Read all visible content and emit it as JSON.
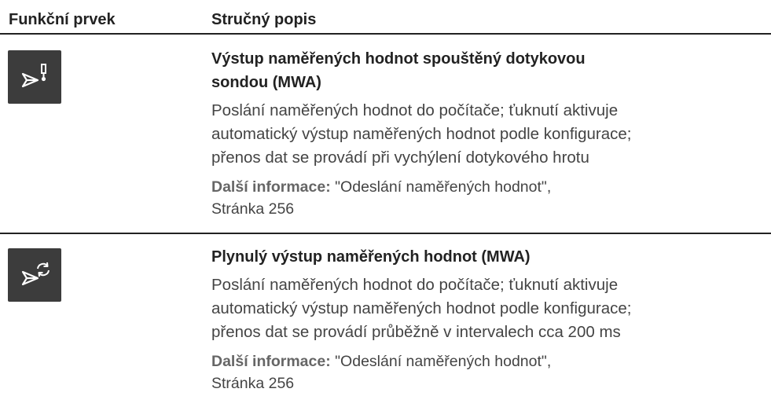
{
  "header": {
    "col1": "Funkční prvek",
    "col2": "Stručný popis"
  },
  "rows": [
    {
      "icon": "probe-triggered-output-icon",
      "title_line1": "Výstup naměřených hodnot spouštěný dotykovou",
      "title_line2": "sondou (MWA)",
      "body_line1": "Poslání naměřených hodnot do počítače; ťuknutí aktivuje",
      "body_line2": "automatický výstup naměřených hodnot podle konfigurace;",
      "body_line3": "přenos dat se provádí při vychýlení dotykového hrotu",
      "more_label": "Další informace:",
      "more_ref": " \"Odeslání naměřených hodnot\",",
      "more_page": "Stránka 256"
    },
    {
      "icon": "continuous-output-icon",
      "title_line1": "Plynulý výstup naměřených hodnot (MWA)",
      "body_line1": "Poslání naměřených hodnot do počítače; ťuknutí aktivuje",
      "body_line2": "automatický výstup naměřených hodnot podle konfigurace;",
      "body_line3": "přenos dat se provádí průběžně v intervalech cca 200 ms",
      "more_label": "Další informace:",
      "more_ref": " \"Odeslání naměřených hodnot\",",
      "more_page": "Stránka 256"
    }
  ],
  "colors": {
    "icon_bg": "#3c3c3c",
    "icon_fg": "#ffffff",
    "rule": "#222222"
  }
}
